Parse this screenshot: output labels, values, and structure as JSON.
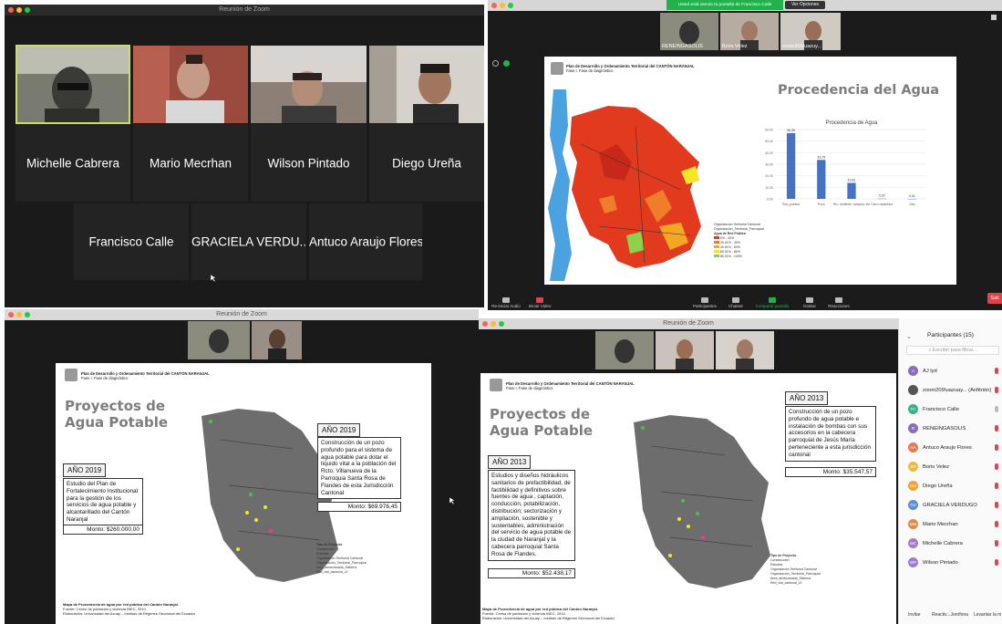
{
  "q1": {
    "window_title": "Reunión de Zoom",
    "row1": [
      "Michelle Cabrera",
      "Mario Mecrhan",
      "Wilson Pintado",
      "Diego Ureña"
    ],
    "row2": [
      "Francisco Calle",
      "GRACIELA VERDU...",
      "Antuco Araujo Flores"
    ]
  },
  "q2": {
    "banner": "Usted está viendo la pantalla de Francisco Calle",
    "options_label": "Ver Opciones",
    "thumb_labels": [
      "RENEINGASOLIS",
      "Boris Velez",
      "zoom209\\uazuy..."
    ],
    "slide_header_line1": "Plan de Desarrollo y Ordenamiento Territorial del CANTÓN NARANJAL",
    "slide_header_line2": "Fase I. Fase de diagnóstico",
    "slide_title": "Procedencia del Agua",
    "map_legend_title": "Agua de Red Pública",
    "map_legend_items": [
      "Organización Territorial Cantonal",
      "Organización_Territorial_Parroquial",
      "0% - 20%",
      "20.01% - 40%",
      "40.01% - 60%",
      "60.01% - 80%",
      "80.01% - 100%"
    ],
    "toolbar": [
      "Re-iniciar Audio",
      "Iniciar Video",
      "Participantes",
      "Chatear",
      "Compartir pantalla",
      "Grabar",
      "Reacciones"
    ],
    "end_label": "Sali",
    "chart_data": {
      "type": "bar",
      "title": "Procedencia de Agua",
      "categories": [
        "Red_pública",
        "Pozo",
        "Río, vertiente, acequia, etc",
        "Carro repartidor",
        "Otro"
      ],
      "values": [
        56.95,
        33.75,
        13.81,
        0.2,
        0.01
      ],
      "value_labels": [
        "56,95",
        "33,75",
        "13,81",
        "0,20",
        "0,01"
      ],
      "ylim": [
        0,
        60
      ],
      "yticks": [
        "0,00",
        "10,00",
        "20,00",
        "30,00",
        "40,00",
        "50,00",
        "60,00"
      ],
      "color": "#4472c4"
    }
  },
  "q3": {
    "window_title": "Reunión de Zoom",
    "slide_header_line1": "Plan de Desarrollo y Ordenamiento Territorial del CANTÓN NARANJAL",
    "slide_header_line2": "Fase I. Fase de diagnóstico",
    "title_line1": "Proyectos de",
    "title_line2": "Agua Potable",
    "left_year": "AÑO 2019",
    "left_text": "Estudio del Plan de Fortalecimiento Institucional para la gestión de los servicios de agua potable y alcantarillado del Cantón Naranjal",
    "left_monto": "Monto: $260.000,00",
    "right_year": "AÑO 2019",
    "right_text": "Construcción de un pozo profundo para el sistema de agua potable para dotar el líquido vital a la población del Rcto. Villanueva de la Parroquia Santa Rosa de Flandes de esta Jurisdicción Cantonal",
    "right_monto": "Monto: $69.976,45",
    "legend_title": "Tipo de Proyecto",
    "legend_items": [
      "Construcción",
      "Estudios",
      "Organización Territorial Cantonal",
      "Organización_Territorial_Parroquial",
      "Área_amanzanada_Sistema",
      "Red_vial_cantonal_v2"
    ],
    "footnote_title": "Mapa de Procedencia de agua por red pública del Cantón Naranjal.",
    "footnote_source": "Fuente: Censo de población y vivienda INEC, 2010.",
    "footnote_elab": "Elaboración: Universidad del Azuay – Instituto de Régimen Seccional del Ecuador"
  },
  "q4": {
    "window_title": "Reunión de Zoom",
    "slide_header_line1": "Plan de Desarrollo y Ordenamiento Territorial del CANTÓN NARANJAL",
    "slide_header_line2": "Fase I. Fase de diagnóstico",
    "title_line1": "Proyectos de",
    "title_line2": "Agua Potable",
    "left_year": "AÑO 2013",
    "left_text": "Estudios y diseños hidráulicos sanitarios de prefactibilidad, de factibilidad y definitivos sobre fuentes de agua , captación, conducción, potabilización, distribución; sectorización y ampliación, sostenible y sustentables, administración del servicio de agua potable de la ciudad de Naranjal y la cabecera parroquial Santa Rosa de Flandes.",
    "left_monto": "Monto: $52.438,17",
    "right_year": "AÑO 2013",
    "right_text": "Construcción de un pozo profundo de agua potable e instalación de bombas con sus accesorios en la cabecera parroquial de Jesús María perteneciente a esta jurisdicción cantonal",
    "right_monto": "Monto: $35.547,57",
    "legend_title": "Tipo de Proyecto",
    "legend_items": [
      "Construcción",
      "Estudios",
      "Organización Territorial Cantonal",
      "Organización_Territorial_Parroquial",
      "Área_amanzanada_Sistema",
      "Red_vial_cantonal_v2"
    ],
    "footnote_title": "Mapa de Procedencia de agua por red pública del Cantón Naranjal.",
    "footnote_source": "Fuente: Censo de población y vivienda INEC, 2010.",
    "footnote_elab": "Elaboración: Universidad del Azuay – Instituto de Régimen Seccional del Ecuador",
    "panel_title": "Participantes (15)",
    "search_placeholder": "Escribir para filtrar...",
    "participants": [
      {
        "initials": "A",
        "name": "AJ lyd",
        "color": "#8e6bbf"
      },
      {
        "initials": "",
        "name": "zoom209\\uazuay... (Anfitrión)",
        "color": "#555555"
      },
      {
        "initials": "FC",
        "name": "Francisco Calle",
        "color": "#3db08a"
      },
      {
        "initials": "R",
        "name": "RENEINGASOLIS",
        "color": "#8e6bbf"
      },
      {
        "initials": "AA",
        "name": "Antuco Araujo Flores",
        "color": "#e07b5b"
      },
      {
        "initials": "BV",
        "name": "Boris Velez",
        "color": "#f0b93c"
      },
      {
        "initials": "DU",
        "name": "Diego Ureña",
        "color": "#f0a03c"
      },
      {
        "initials": "GV",
        "name": "GRACIELA VERDUGO",
        "color": "#5b8fd6"
      },
      {
        "initials": "MM",
        "name": "Mario Mecrhan",
        "color": "#e08a4a"
      },
      {
        "initials": "MC",
        "name": "Michelle Cabrera",
        "color": "#a07ad0"
      },
      {
        "initials": "WP",
        "name": "Wilson Pintado",
        "color": "#a07ad0"
      }
    ],
    "panel_buttons": [
      "Invitar",
      "Reactiv...Jorófona",
      "Levantar la m"
    ]
  }
}
